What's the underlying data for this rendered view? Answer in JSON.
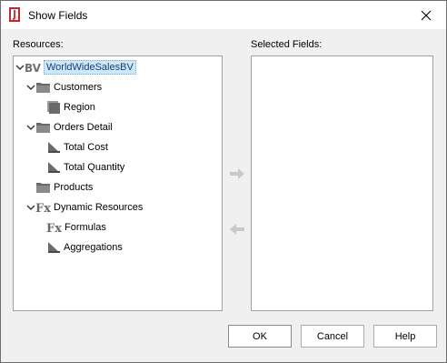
{
  "window": {
    "title": "Show Fields"
  },
  "resources": {
    "label": "Resources:",
    "tree": [
      {
        "label": "WorldWideSalesBV",
        "icon": "bv-icon",
        "expanded": true,
        "selected": true
      },
      {
        "label": "Customers",
        "icon": "folder-icon",
        "expanded": true
      },
      {
        "label": "Region",
        "icon": "dimension-icon"
      },
      {
        "label": "Orders Detail",
        "icon": "folder-icon",
        "expanded": true
      },
      {
        "label": "Total Cost",
        "icon": "measure-icon"
      },
      {
        "label": "Total Quantity",
        "icon": "measure-icon"
      },
      {
        "label": "Products",
        "icon": "folder-icon"
      },
      {
        "label": "Dynamic Resources",
        "icon": "fx-icon",
        "expanded": true
      },
      {
        "label": "Formulas",
        "icon": "fx-icon"
      },
      {
        "label": "Aggregations",
        "icon": "measure-icon"
      }
    ]
  },
  "selected_fields": {
    "label": "Selected Fields:",
    "items": []
  },
  "buttons": {
    "ok": "OK",
    "cancel": "Cancel",
    "help": "Help"
  }
}
